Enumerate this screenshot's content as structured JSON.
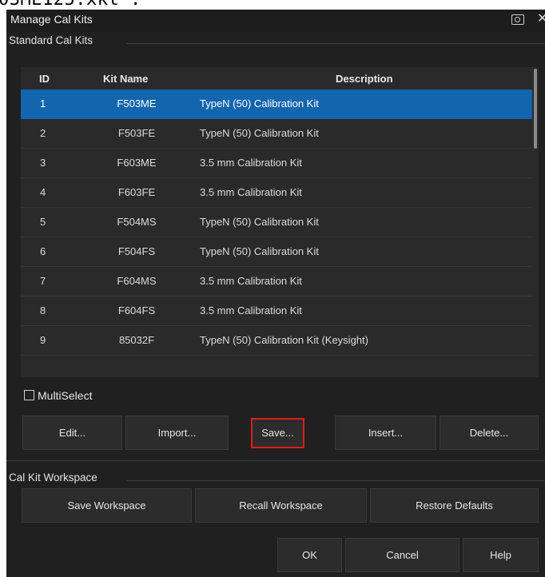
{
  "top_strip_text": "03ME125.xkt'.",
  "dialog": {
    "title": "Manage Cal Kits",
    "icons": {
      "screenshot": "camera-icon",
      "close": "close-icon"
    },
    "standard_group": "Standard Cal Kits",
    "table": {
      "headers": {
        "id": "ID",
        "name": "Kit Name",
        "description": "Description"
      },
      "rows": [
        {
          "id": "1",
          "name": "F503ME",
          "description": "TypeN (50) Calibration Kit",
          "selected": true
        },
        {
          "id": "2",
          "name": "F503FE",
          "description": "TypeN (50) Calibration Kit"
        },
        {
          "id": "3",
          "name": "F603ME",
          "description": "3.5 mm Calibration Kit"
        },
        {
          "id": "4",
          "name": "F603FE",
          "description": "3.5 mm Calibration Kit"
        },
        {
          "id": "5",
          "name": "F504MS",
          "description": "TypeN (50) Calibration Kit"
        },
        {
          "id": "6",
          "name": "F504FS",
          "description": "TypeN (50) Calibration Kit"
        },
        {
          "id": "7",
          "name": "F604MS",
          "description": "3.5 mm Calibration Kit"
        },
        {
          "id": "8",
          "name": "F604FS",
          "description": "3.5 mm Calibration Kit"
        },
        {
          "id": "9",
          "name": "85032F",
          "description": "TypeN (50) Calibration Kit (Keysight)"
        }
      ]
    },
    "multiselect_label": "MultiSelect",
    "kit_buttons": {
      "edit": "Edit...",
      "import": "Import...",
      "save": "Save...",
      "insert": "Insert...",
      "delete": "Delete..."
    },
    "workspace_group": "Cal Kit Workspace",
    "workspace_buttons": {
      "save": "Save Workspace",
      "recall": "Recall Workspace",
      "restore": "Restore Defaults"
    },
    "footer_buttons": {
      "ok": "OK",
      "cancel": "Cancel",
      "help": "Help"
    }
  },
  "colors": {
    "background": "#202020",
    "selection": "#1365ad",
    "highlight_border": "#e21b1b"
  }
}
